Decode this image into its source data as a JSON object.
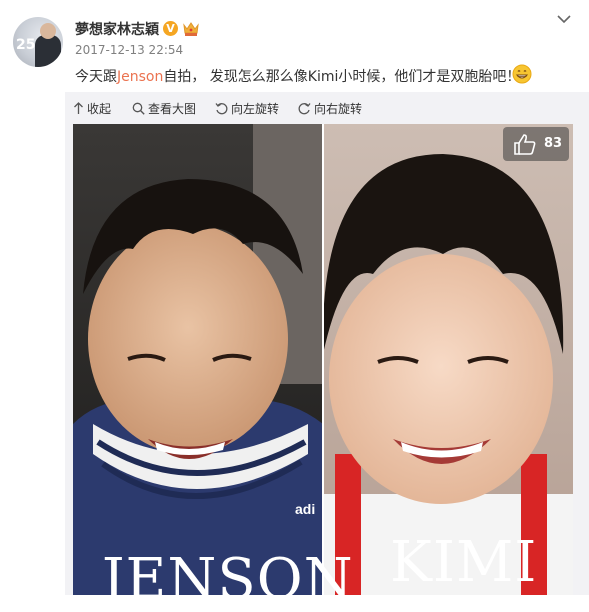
{
  "post": {
    "username": "夢想家林志穎",
    "verified_badge": "V",
    "timestamp": "2017-12-13 22:54",
    "text_before": "今天跟",
    "mention": "Jenson",
    "text_after": "自拍， 发现怎么那么像Kimi小时候，他们才是双胞胎吧！",
    "emoji": "grinning-face-icon",
    "avatar_text": "25",
    "accent_color": "#eb7350"
  },
  "toolbar": {
    "collapse_label": "收起",
    "view_large_label": "查看大图",
    "rotate_left_label": "向左旋转",
    "rotate_right_label": "向右旋转"
  },
  "photo": {
    "like_count": "83",
    "left_name": "JENSON",
    "right_name": "KIMI",
    "shirt_logo": "adi"
  },
  "colors": {
    "mention": "#eb7350",
    "mediabox_bg": "#f2f2f5",
    "text": "#333333",
    "meta": "#808080"
  }
}
